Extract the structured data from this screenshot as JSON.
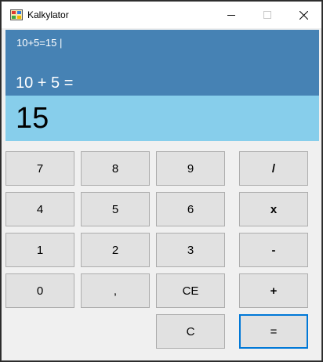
{
  "window": {
    "title": "Kalkylator"
  },
  "display": {
    "history": "10+5=15 |",
    "expression": "10 + 5 =",
    "result": "15"
  },
  "keys": {
    "seven": "7",
    "eight": "8",
    "nine": "9",
    "divide": "/",
    "four": "4",
    "five": "5",
    "six": "6",
    "multiply": "x",
    "one": "1",
    "two": "2",
    "three": "3",
    "minus": "-",
    "zero": "0",
    "comma": ",",
    "clear_entry": "CE",
    "plus": "+",
    "clear": "C",
    "equals": "="
  },
  "colors": {
    "history_background": "#4682b4",
    "result_background": "#87ceeb",
    "key_background": "#e1e1e1",
    "focus_border": "#0078d7"
  },
  "icons": {
    "app": "calculator-app-icon",
    "minimize": "minimize-icon",
    "maximize": "maximize-icon",
    "close": "close-icon"
  }
}
